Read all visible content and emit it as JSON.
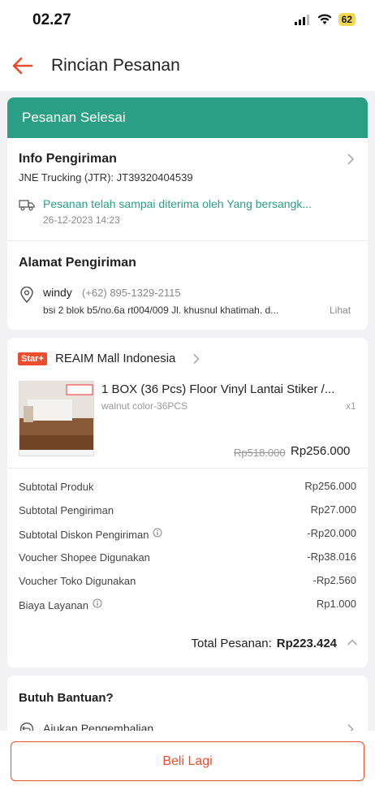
{
  "status_bar": {
    "time": "02.27",
    "battery": "62"
  },
  "header": {
    "title": "Rincian Pesanan"
  },
  "order_status": "Pesanan Selesai",
  "shipping_info": {
    "title": "Info Pengiriman",
    "courier": "JNE Trucking (JTR): JT39320404539",
    "status_text": "Pesanan telah sampai diterima oleh Yang bersangk...",
    "timestamp": "26-12-2023 14:23"
  },
  "address": {
    "title": "Alamat Pengiriman",
    "name": "windy",
    "phone": "(+62) 895-1329-2115",
    "line": "bsi 2 blok b5/no.6a rt004/009 Jl. khusnul khatimah. d...",
    "see_more": "Lihat"
  },
  "shop": {
    "badge": "Star+",
    "name": "REAIM Mall Indonesia"
  },
  "product": {
    "title": "1 BOX (36 Pcs) Floor Vinyl Lantai Stiker /...",
    "variant": "walnut color-36PCS",
    "qty": "x1",
    "original_price": "Rp518.000",
    "price": "Rp256.000"
  },
  "summary": [
    {
      "label": "Subtotal Produk",
      "value": "Rp256.000",
      "info": false
    },
    {
      "label": "Subtotal Pengiriman",
      "value": "Rp27.000",
      "info": false
    },
    {
      "label": "Subtotal Diskon Pengiriman",
      "value": "-Rp20.000",
      "info": true
    },
    {
      "label": "Voucher Shopee Digunakan",
      "value": "-Rp38.016",
      "info": false
    },
    {
      "label": "Voucher Toko Digunakan",
      "value": "-Rp2.560",
      "info": false
    },
    {
      "label": "Biaya Layanan",
      "value": "Rp1.000",
      "info": true
    }
  ],
  "total": {
    "label": "Total Pesanan:",
    "value": "Rp223.424"
  },
  "help": {
    "title": "Butuh Bantuan?",
    "return_label": "Ajukan Pengembalian"
  },
  "buy_again_label": "Beli Lagi",
  "colors": {
    "accent": "#ee4d2d",
    "status_green": "#2a9f85"
  }
}
